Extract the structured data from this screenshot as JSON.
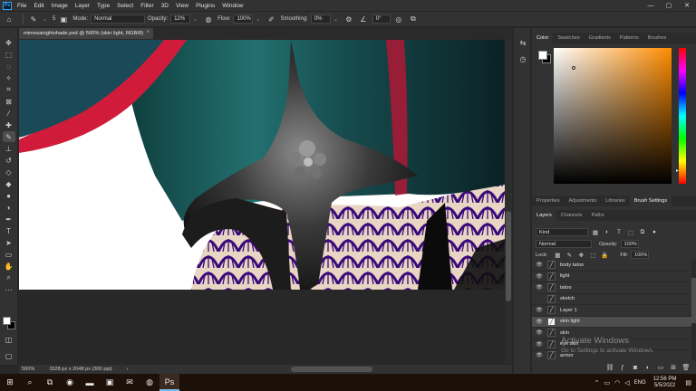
{
  "app": {
    "logo_text": "Ps",
    "menu": [
      "File",
      "Edit",
      "Image",
      "Layer",
      "Type",
      "Select",
      "Filter",
      "3D",
      "View",
      "Plugins",
      "Window"
    ],
    "window_controls": [
      "—",
      "▢",
      "✕"
    ]
  },
  "options_bar": {
    "mode_label": "Mode:",
    "mode_value": "Normal",
    "opacity_label": "Opacity:",
    "opacity_value": "12%",
    "flow_label": "Flow:",
    "flow_value": "100%",
    "smoothing_label": "Smoothing:",
    "smoothing_value": "0%",
    "angle_value": "0°",
    "brush_size": "5"
  },
  "document": {
    "tab_title": "mimosanightshade.psd @ 500% (skin light, RGB/8)",
    "tab_close": "×",
    "zoom": "500%",
    "dimensions": "1528 px x 2048 px (300 ppi)"
  },
  "color_panel": {
    "tabs": [
      "Color",
      "Swatches",
      "Gradients",
      "Patterns",
      "Brushes"
    ],
    "active_tab": "Color",
    "base_hue_hex": "#ff8c00"
  },
  "properties_panel": {
    "tabs": [
      "Properties",
      "Adjustments",
      "Libraries",
      "Brush Settings"
    ],
    "active_tab": "Brush Settings"
  },
  "layers_panel": {
    "tabs": [
      "Layers",
      "Channels",
      "Paths"
    ],
    "active_tab": "Layers",
    "filter_kind": "Kind",
    "blend_mode": "Normal",
    "opacity_label": "Opacity:",
    "opacity_value": "100%",
    "lock_label": "Lock:",
    "fill_label": "Fill:",
    "fill_value": "100%",
    "layers": [
      {
        "name": "body tatoo",
        "visible": true,
        "selected": false
      },
      {
        "name": "light",
        "visible": true,
        "selected": false
      },
      {
        "name": "tatoo",
        "visible": true,
        "selected": false
      },
      {
        "name": "sketch",
        "visible": false,
        "selected": false
      },
      {
        "name": "Layer 1",
        "visible": true,
        "selected": false
      },
      {
        "name": "skin light",
        "visible": true,
        "selected": true
      },
      {
        "name": "skin",
        "visible": true,
        "selected": false
      },
      {
        "name": "eye skin",
        "visible": true,
        "selected": false
      },
      {
        "name": "armor",
        "visible": true,
        "selected": false
      }
    ]
  },
  "watermark": {
    "title": "Activate Windows",
    "subtitle": "Go to Settings to activate Windows."
  },
  "taskbar": {
    "language": "ENG",
    "time": "12:56 PM",
    "date": "5/5/2022"
  }
}
